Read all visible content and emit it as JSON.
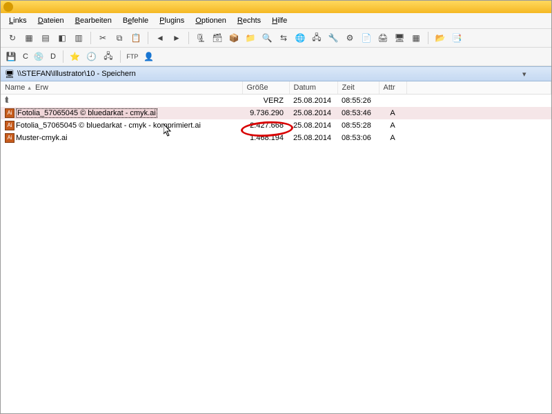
{
  "menu": {
    "links": "Links",
    "dateien": "Dateien",
    "bearbeiten": "Bearbeiten",
    "befehle": "Befehle",
    "plugins": "Plugins",
    "optionen": "Optionen",
    "rechts": "Rechts",
    "hilfe": "Hilfe"
  },
  "drives": {
    "c": "C",
    "d": "D"
  },
  "path": "\\\\STEFAN\\Illustrator\\10 - Speichern",
  "columns": {
    "name": "Name",
    "erw": "Erw",
    "groesse": "Größe",
    "datum": "Datum",
    "zeit": "Zeit",
    "attr": "Attr"
  },
  "rows": [
    {
      "icon": "updir",
      "name": "..",
      "size": "VERZ",
      "date": "25.08.2014",
      "time": "08:55:26",
      "attr": ""
    },
    {
      "icon": "ai",
      "name": "Fotolia_57065045 © bluedarkat - cmyk.ai",
      "size": "9.736.290",
      "date": "25.08.2014",
      "time": "08:53:46",
      "attr": "A",
      "selected": true
    },
    {
      "icon": "ai",
      "name": "Fotolia_57065045 © bluedarkat - cmyk - komprimiert.ai",
      "size": "2.427.668",
      "date": "25.08.2014",
      "time": "08:55:28",
      "attr": "A"
    },
    {
      "icon": "ai",
      "name": "Muster-cmyk.ai",
      "size": "1.468.194",
      "date": "25.08.2014",
      "time": "08:53:06",
      "attr": "A"
    }
  ]
}
